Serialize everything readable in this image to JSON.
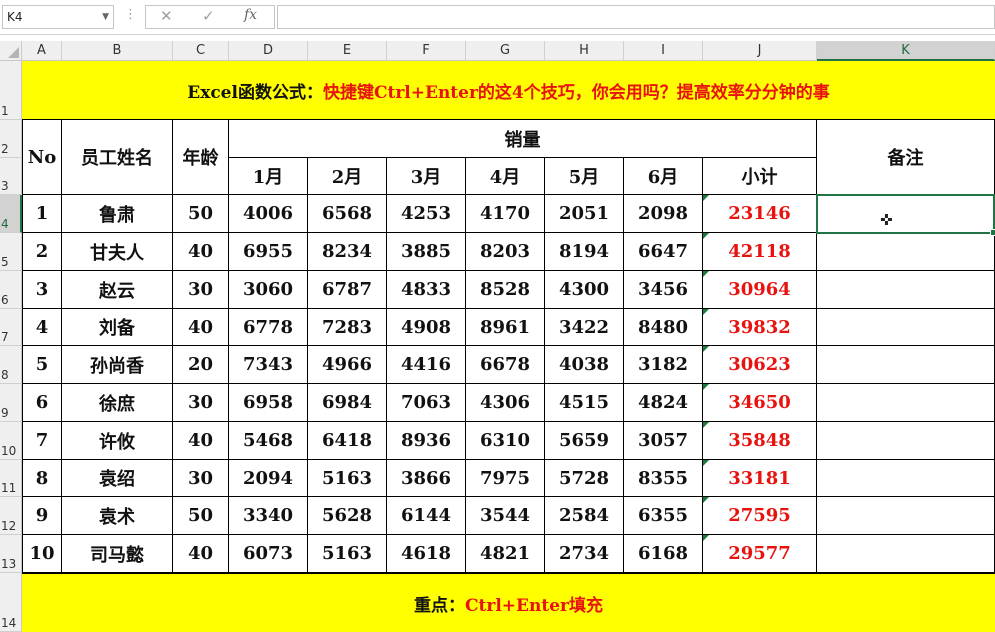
{
  "formula_bar": {
    "name_box": "K4",
    "cancel_icon": "✕",
    "enter_icon": "✓",
    "fx_label": "fx",
    "formula_value": ""
  },
  "columns": [
    "A",
    "B",
    "C",
    "D",
    "E",
    "F",
    "G",
    "H",
    "I",
    "J",
    "K"
  ],
  "rows": [
    "1",
    "2",
    "3",
    "4",
    "5",
    "6",
    "7",
    "8",
    "9",
    "10",
    "11",
    "12",
    "13",
    "14"
  ],
  "selected_cell": "K4",
  "sheet": {
    "title_prefix": "Excel函数公式：",
    "title_rest": "快捷键Ctrl+Enter的这4个技巧，你会用吗？提高效率分分钟的事",
    "headers": {
      "no": "No",
      "name": "员工姓名",
      "age": "年龄",
      "sales": "销量",
      "remark": "备注",
      "months": [
        "1月",
        "2月",
        "3月",
        "4月",
        "5月",
        "6月"
      ],
      "subtotal": "小计"
    },
    "records": [
      {
        "no": "1",
        "name": "鲁肃",
        "age": "50",
        "m": [
          "4006",
          "6568",
          "4253",
          "4170",
          "2051",
          "2098"
        ],
        "total": "23146"
      },
      {
        "no": "2",
        "name": "甘夫人",
        "age": "40",
        "m": [
          "6955",
          "8234",
          "3885",
          "8203",
          "8194",
          "6647"
        ],
        "total": "42118"
      },
      {
        "no": "3",
        "name": "赵云",
        "age": "30",
        "m": [
          "3060",
          "6787",
          "4833",
          "8528",
          "4300",
          "3456"
        ],
        "total": "30964"
      },
      {
        "no": "4",
        "name": "刘备",
        "age": "40",
        "m": [
          "6778",
          "7283",
          "4908",
          "8961",
          "3422",
          "8480"
        ],
        "total": "39832"
      },
      {
        "no": "5",
        "name": "孙尚香",
        "age": "20",
        "m": [
          "7343",
          "4966",
          "4416",
          "6678",
          "4038",
          "3182"
        ],
        "total": "30623"
      },
      {
        "no": "6",
        "name": "徐庶",
        "age": "30",
        "m": [
          "6958",
          "6984",
          "7063",
          "4306",
          "4515",
          "4824"
        ],
        "total": "34650"
      },
      {
        "no": "7",
        "name": "许攸",
        "age": "40",
        "m": [
          "5468",
          "6418",
          "8936",
          "6310",
          "5659",
          "3057"
        ],
        "total": "35848"
      },
      {
        "no": "8",
        "name": "袁绍",
        "age": "30",
        "m": [
          "2094",
          "5163",
          "3866",
          "7975",
          "5728",
          "8355"
        ],
        "total": "33181"
      },
      {
        "no": "9",
        "name": "袁术",
        "age": "50",
        "m": [
          "3340",
          "5628",
          "6144",
          "3544",
          "2584",
          "6355"
        ],
        "total": "27595"
      },
      {
        "no": "10",
        "name": "司马懿",
        "age": "40",
        "m": [
          "6073",
          "5163",
          "4618",
          "4821",
          "2734",
          "6168"
        ],
        "total": "29577"
      }
    ],
    "footer_prefix": "重点：",
    "footer_rest": "Ctrl+Enter填充"
  },
  "colors": {
    "banner_bg": "#ffff00",
    "red_text": "#e8130f",
    "selection": "#217346"
  }
}
